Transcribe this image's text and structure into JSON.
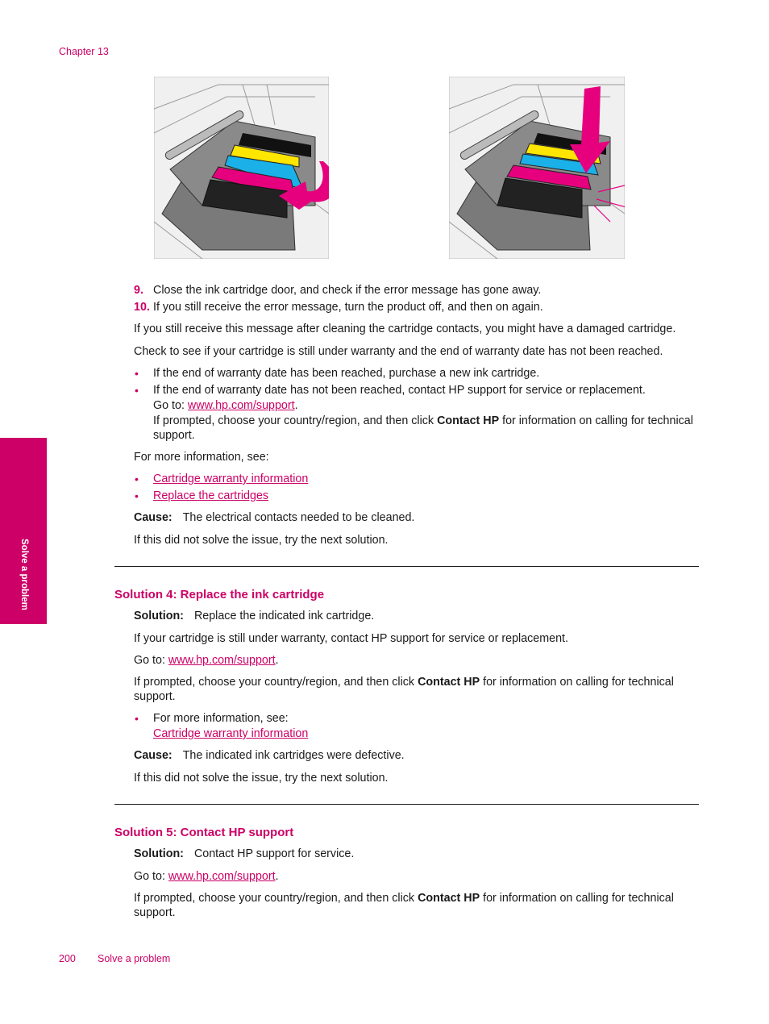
{
  "header": {
    "running_head": "Chapter 13"
  },
  "side_tab": {
    "label": "Solve a problem",
    "color": "#cc0066"
  },
  "figures": [
    {
      "name": "figure-close-latch",
      "description": "Printhead carriage with ink cartridges installed; pink curved arrow indicating latch closing",
      "colors": [
        "#000000",
        "#ffe600",
        "#1ab0e8",
        "#e6007e"
      ]
    },
    {
      "name": "figure-press-down",
      "description": "Printhead carriage with pink downward arrow pressing cartridge into place; callout lines on right",
      "colors": [
        "#000000",
        "#ffe600",
        "#1ab0e8",
        "#e6007e"
      ]
    }
  ],
  "steps": [
    {
      "num": "9.",
      "text": "Close the ink cartridge door, and check if the error message has gone away."
    },
    {
      "num": "10.",
      "text": "If you still receive the error message, turn the product off, and then on again."
    }
  ],
  "para_damaged": "If you still receive this message after cleaning the cartridge contacts, you might have a damaged cartridge.",
  "para_warranty_check": "Check to see if your cartridge is still under warranty and the end of warranty date has not been reached.",
  "warranty_bullets": {
    "b1": "If the end of warranty date has been reached, purchase a new ink cartridge.",
    "b2": "If the end of warranty date has not been reached, contact HP support for service or replacement.",
    "goto_prefix": "Go to: ",
    "goto_link": "www.hp.com/support",
    "goto_suffix": ".",
    "prompt_prefix": "If prompted, choose your country/region, and then click ",
    "prompt_bold": "Contact HP",
    "prompt_suffix": " for information on calling for technical",
    "prompt_line2": "support."
  },
  "more_info": {
    "label": "For more information, see:",
    "links": [
      "Cartridge warranty information",
      "Replace the cartridges"
    ]
  },
  "cause3": {
    "label": "Cause:",
    "text": "The electrical contacts needed to be cleaned."
  },
  "next3": "If this did not solve the issue, try the next solution.",
  "solution4": {
    "heading": "Solution 4: Replace the ink cartridge",
    "solution_label": "Solution:",
    "solution_text": "Replace the indicated ink cartridge.",
    "warranty": "If your cartridge is still under warranty, contact HP support for service or replacement.",
    "goto_prefix": "Go to: ",
    "goto_link": "www.hp.com/support",
    "goto_suffix": ".",
    "prompt_prefix": "If prompted, choose your country/region, and then click ",
    "prompt_bold": "Contact HP",
    "prompt_suffix": " for information on calling for technical",
    "prompt_line2": "support.",
    "more_info_label": "For more information, see:",
    "more_info_link": "Cartridge warranty information",
    "cause_label": "Cause:",
    "cause_text": "The indicated ink cartridges were defective.",
    "next": "If this did not solve the issue, try the next solution."
  },
  "solution5": {
    "heading": "Solution 5: Contact HP support",
    "solution_label": "Solution:",
    "solution_text": "Contact HP support for service.",
    "goto_prefix": "Go to: ",
    "goto_link": "www.hp.com/support",
    "goto_suffix": ".",
    "prompt_prefix": "If prompted, choose your country/region, and then click ",
    "prompt_bold": "Contact HP",
    "prompt_suffix": " for information on calling for technical",
    "prompt_line2": "support."
  },
  "footer": {
    "page_number": "200",
    "section_title": "Solve a problem"
  }
}
